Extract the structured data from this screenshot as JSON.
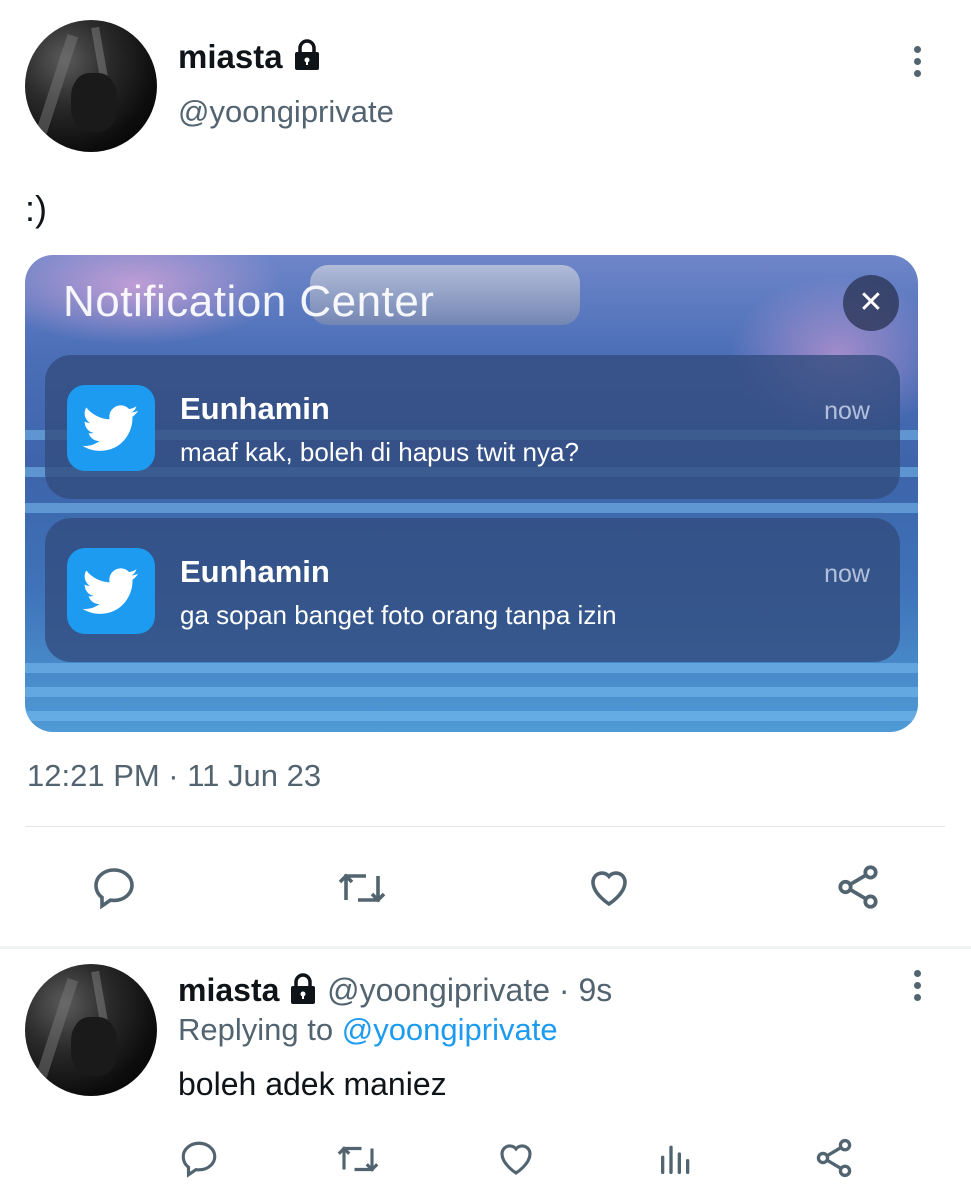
{
  "tweet": {
    "author_name": "miasta",
    "author_handle": "@yoongiprivate",
    "text": ":)",
    "timestamp": "12:21 PM · 11 Jun 23",
    "media": {
      "header": "Notification Center",
      "notifications": [
        {
          "app": "twitter-icon",
          "title": "Eunhamin",
          "time": "now",
          "body": "maaf kak, boleh di hapus twit nya?"
        },
        {
          "app": "twitter-icon",
          "title": "Eunhamin",
          "time": "now",
          "body": "ga sopan banget foto orang tanpa izin"
        }
      ]
    },
    "actions": [
      "reply-icon",
      "retweet-icon",
      "like-icon",
      "share-icon"
    ]
  },
  "reply": {
    "author_name": "miasta",
    "author_handle": "@yoongiprivate",
    "separator": " · ",
    "age": "9s",
    "replying_prefix": "Replying to ",
    "replying_to": "@yoongiprivate",
    "text": "boleh adek maniez",
    "actions": [
      "reply-icon",
      "retweet-icon",
      "like-icon",
      "analytics-icon",
      "share-icon"
    ]
  },
  "colors": {
    "text": "#0f1419",
    "secondary": "#536471",
    "accent": "#1d9bf0"
  }
}
